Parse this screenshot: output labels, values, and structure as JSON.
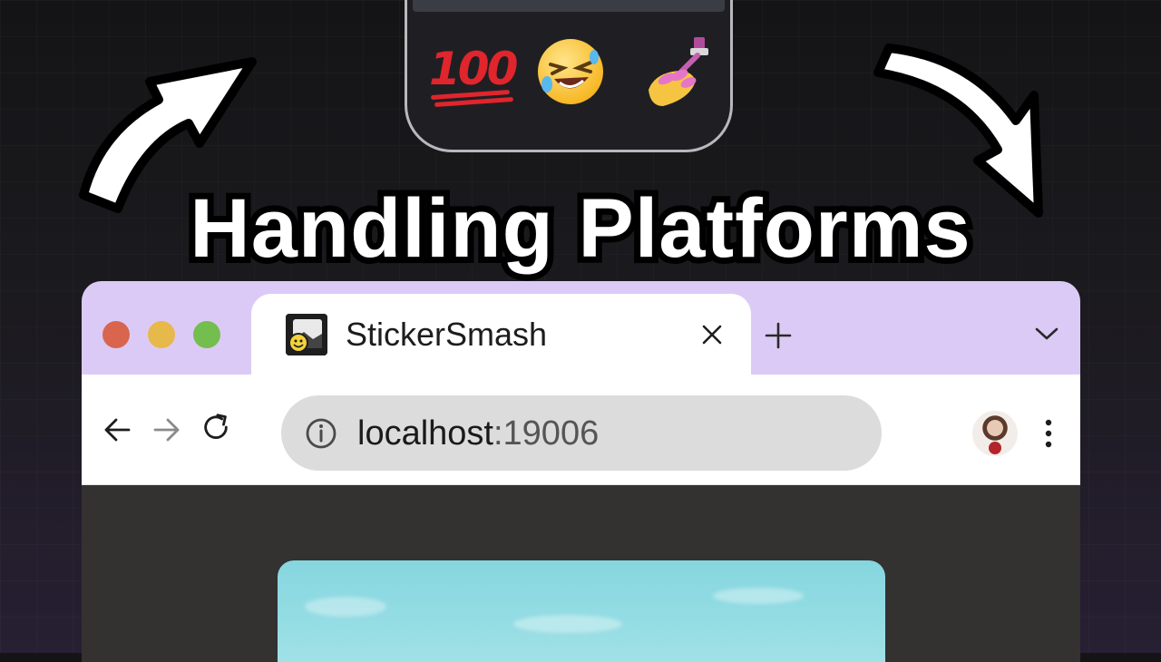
{
  "headline": "Handling Platforms",
  "phone": {
    "emojis": [
      "100-emoji",
      "rolling-on-floor-laughing-emoji",
      "nail-polish-emoji"
    ],
    "emoji_100_text": "100"
  },
  "browser": {
    "tab": {
      "title": "StickerSmash",
      "favicon": "stickersmash-favicon"
    },
    "address": {
      "host": "localhost",
      "port": ":19006"
    },
    "icons": {
      "back": "arrow-left-icon",
      "forward": "arrow-right-icon",
      "reload": "reload-icon",
      "info": "info-icon",
      "menu": "kebab-menu-icon"
    },
    "colors": {
      "tabbar": "#dccaf6",
      "traffic_red": "#d9654f",
      "traffic_yellow": "#e7b84a",
      "traffic_green": "#74bd4f",
      "content_bg": "#343131"
    }
  }
}
